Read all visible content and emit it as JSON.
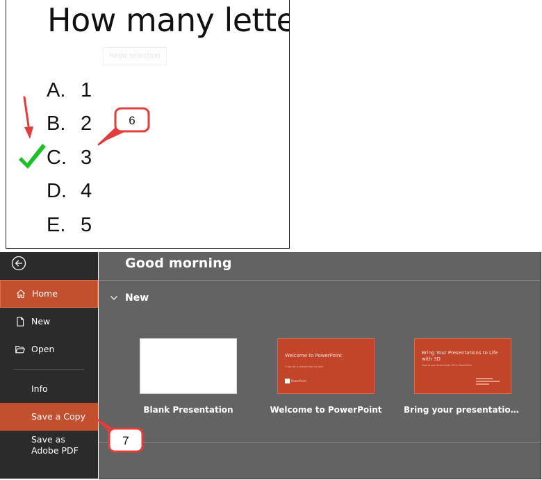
{
  "slide": {
    "title": "How many letter",
    "reorder_tag": "Redo selection",
    "options": [
      {
        "letter": "A.",
        "value": "1"
      },
      {
        "letter": "B.",
        "value": "2"
      },
      {
        "letter": "C.",
        "value": "3"
      },
      {
        "letter": "D.",
        "value": "4"
      },
      {
        "letter": "E.",
        "value": "5"
      }
    ],
    "correct_option": "C."
  },
  "backstage": {
    "greeting": "Good morning",
    "new_section_label": "New",
    "nav": {
      "home": "Home",
      "new": "New",
      "open": "Open",
      "info": "Info",
      "save_copy": "Save a Copy",
      "save_pdf": "Save as Adobe PDF"
    },
    "templates": [
      {
        "label": "Blank Presentation",
        "thumb_title": "",
        "thumb_sub": ""
      },
      {
        "label": "Welcome to PowerPoint",
        "thumb_title": "Welcome to PowerPoint",
        "thumb_sub": "5 tips for a simpler way to work",
        "thumb_brand": "PowerPoint"
      },
      {
        "label": "Bring your presentations to l...",
        "thumb_title": "Bring Your Presentations to Life with 3D",
        "thumb_sub": "How to get started with 3D in PowerPoint"
      }
    ]
  },
  "annotations": {
    "step_6": "6",
    "step_7": "7",
    "color_callout": "#e23c3c",
    "color_check": "#1fbf2a"
  },
  "colors": {
    "sidebar_bg": "#2b2b2b",
    "main_bg": "#636363",
    "accent": "#c2502f"
  }
}
